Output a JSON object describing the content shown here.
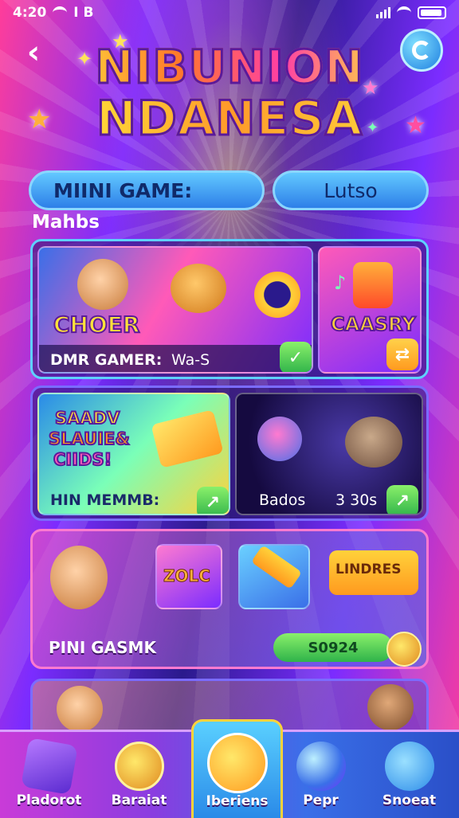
{
  "status_bar": {
    "time": "4:20",
    "extra": "I B"
  },
  "header": {
    "title_line1": "NIBUNION",
    "title_line2": "NDANESA"
  },
  "pills": {
    "left": "MIINI GAME:",
    "right": "Lutso"
  },
  "section": {
    "label": "Mahbs"
  },
  "panel1": {
    "tile1": {
      "title": "CHOER",
      "label": "DMR GAMER:",
      "sublabel": "Wa-S"
    },
    "tile2": {
      "title": "CAASRY"
    }
  },
  "panel2": {
    "tile1": {
      "title_line1": "SAADV",
      "title_line2": "SLAUIE&",
      "title_line3": "CIIDS!",
      "label": "HIN MEMMB:"
    },
    "tile2": {
      "label": "Bados",
      "value": "3 30s"
    }
  },
  "panel3": {
    "badge1": "ZOLC",
    "badge2": "LINDRES",
    "label": "PINI GASMK",
    "progress_value": "S0924"
  },
  "bottom_nav": {
    "items": [
      {
        "label": "Pladorot",
        "icon": "cube-icon"
      },
      {
        "label": "Baraiat",
        "icon": "coin-icon"
      },
      {
        "label": "Iberiens",
        "icon": "phone-icon"
      },
      {
        "label": "Pepr",
        "icon": "orb-icon"
      },
      {
        "label": "Snoeat",
        "icon": "chat-coin-icon"
      }
    ],
    "active_index": 2
  }
}
